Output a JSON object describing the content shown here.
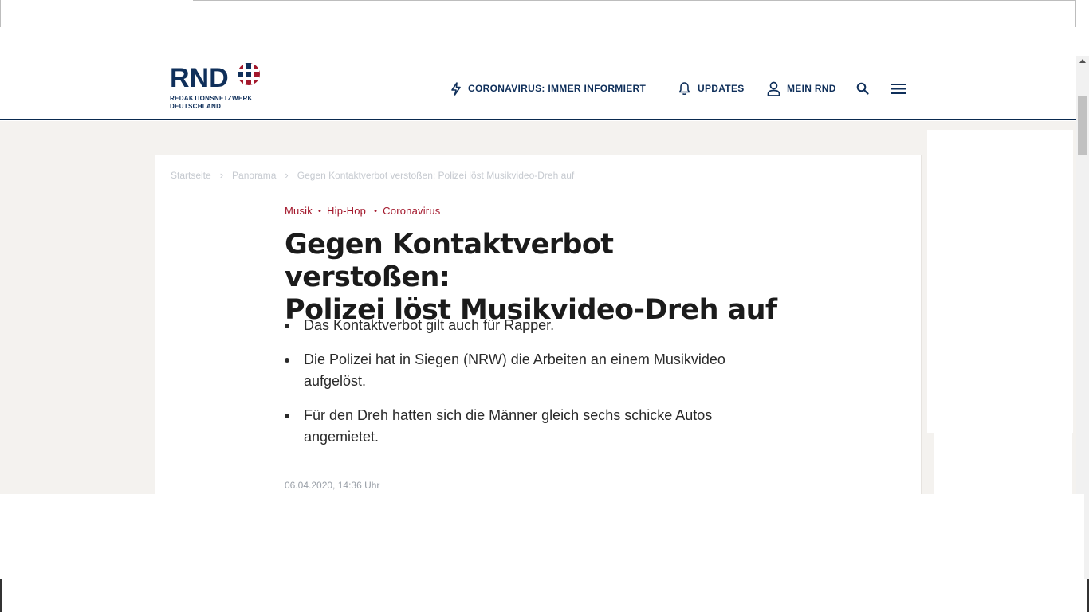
{
  "header": {
    "logo": {
      "wordmark": "RND",
      "line1": "REDAKTIONSNETZWERK",
      "line2": "DEUTSCHLAND",
      "colors": {
        "navy": "#0f2f5a",
        "red": "#a3172b"
      }
    },
    "nav": {
      "corona_label": "CORONAVIRUS: IMMER INFORMIERT",
      "corona_icon": "lightning-icon",
      "updates_label": "UPDATES",
      "updates_icon": "bell-icon",
      "mein_label": "MEIN RND",
      "mein_icon": "user-icon",
      "search_icon": "search-icon",
      "menu_icon": "hamburger-menu-icon"
    }
  },
  "breadcrumb": {
    "items": [
      "Startseite",
      "Panorama",
      "Gegen Kontaktverbot verstoßen: Polizei löst Musikvideo-Dreh auf"
    ]
  },
  "article": {
    "tags": [
      "Musik",
      "Hip-Hop",
      "Coronavirus"
    ],
    "headline_line1": "Gegen Kontaktverbot verstoßen:",
    "headline_line2": "Polizei löst Musikvideo-Dreh auf",
    "bullets": [
      "Das Kontaktverbot gilt auch für Rapper.",
      "Die Polizei hat in Siegen (NRW) die Arbeiten an einem Musikvideo aufgelöst.",
      "Für den Dreh hatten sich die Männer gleich sechs schicke Autos angemietet."
    ],
    "date": "06.04.2020, 14:36 Uhr"
  },
  "colors": {
    "accent": "#a3172b",
    "navy": "#0f2f5a",
    "page_bg": "#f4f2ef"
  }
}
